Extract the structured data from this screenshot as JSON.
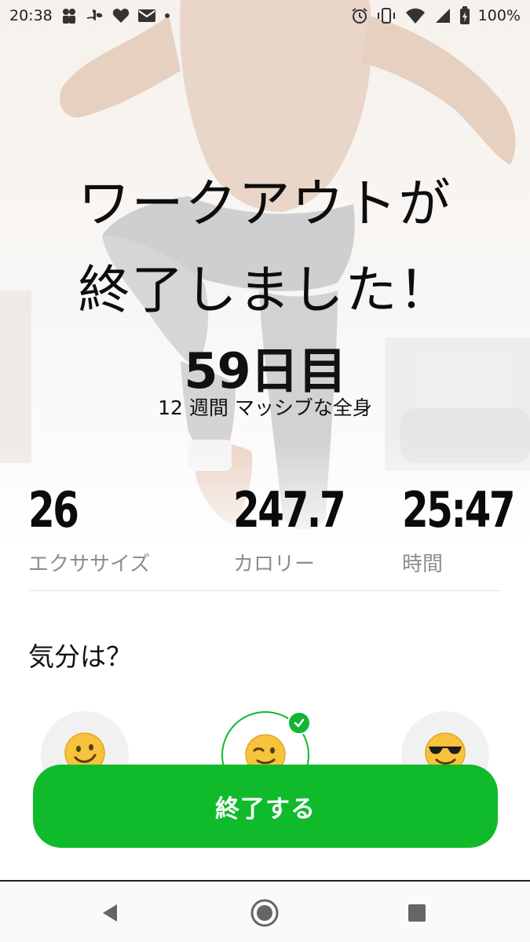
{
  "status_bar": {
    "time": "20:38",
    "battery": "100%",
    "left_icons": [
      "notification-icon",
      "playstation-icon",
      "heart-icon",
      "au-mail-icon",
      "dot-icon"
    ],
    "right_icons": [
      "alarm-icon",
      "vibrate-icon",
      "wifi-icon",
      "signal-icon",
      "battery-icon"
    ]
  },
  "header": {
    "title_line1": "ワークアウトが",
    "title_line2": "終了しました！",
    "day_label": "59日目",
    "program_name": "12 週間 マッシブな全身"
  },
  "stats": [
    {
      "value": "26",
      "label": "エクササイズ"
    },
    {
      "value": "247.7",
      "label": "カロリー"
    },
    {
      "value": "25:47",
      "label": "時間"
    }
  ],
  "mood": {
    "title": "気分は？",
    "options": [
      {
        "icon": "smiling-face-icon",
        "selected": false
      },
      {
        "icon": "winking-face-icon",
        "selected": true
      },
      {
        "icon": "sunglasses-face-icon",
        "selected": false
      }
    ]
  },
  "actions": {
    "finish_label": "終了する"
  },
  "colors": {
    "accent": "#0fbb2b",
    "label_gray": "#8e8e8e"
  },
  "nav": {
    "icons": [
      "back-icon",
      "home-icon",
      "recents-icon"
    ]
  }
}
